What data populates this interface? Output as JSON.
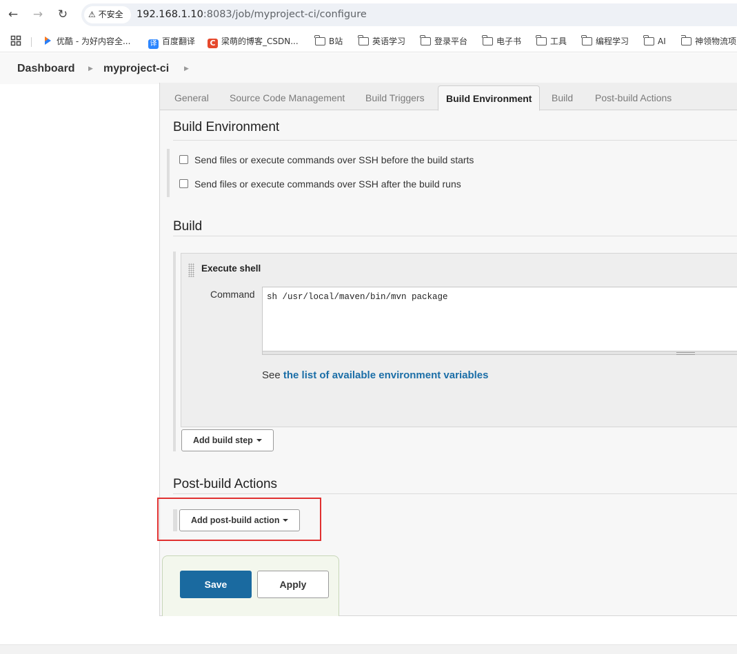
{
  "browser": {
    "security_label": "不安全",
    "url_host": "192.168.1.10",
    "url_rest": ":8083/job/myproject-ci/configure"
  },
  "bookmarks": [
    {
      "label": "优酷 - 为好内容全...",
      "icon": "youku-icon",
      "color": "#2b7ff6"
    },
    {
      "label": "百度翻译",
      "icon": "translate-icon",
      "color": "#2c86ff"
    },
    {
      "label": "梁萌的博客_CSDN...",
      "icon": "csdn-icon",
      "color": "#e6492d"
    },
    {
      "label": "B站",
      "icon": "folder-icon"
    },
    {
      "label": "英语学习",
      "icon": "folder-icon"
    },
    {
      "label": "登录平台",
      "icon": "folder-icon"
    },
    {
      "label": "电子书",
      "icon": "folder-icon"
    },
    {
      "label": "工具",
      "icon": "folder-icon"
    },
    {
      "label": "编程学习",
      "icon": "folder-icon"
    },
    {
      "label": "AI",
      "icon": "folder-icon"
    },
    {
      "label": "神领物流项",
      "icon": "folder-icon"
    }
  ],
  "breadcrumb": {
    "dashboard": "Dashboard",
    "project": "myproject-ci"
  },
  "tabs": [
    {
      "label": "General"
    },
    {
      "label": "Source Code Management"
    },
    {
      "label": "Build Triggers"
    },
    {
      "label": "Build Environment",
      "active": true
    },
    {
      "label": "Build"
    },
    {
      "label": "Post-build Actions"
    }
  ],
  "build_env": {
    "title": "Build Environment",
    "options": [
      {
        "label": "Send files or execute commands over SSH before the build starts",
        "checked": false
      },
      {
        "label": "Send files or execute commands over SSH after the build runs",
        "checked": false
      }
    ]
  },
  "build": {
    "title": "Build",
    "step_title": "Execute shell",
    "command_label": "Command",
    "command_value": "sh /usr/local/maven/bin/mvn package",
    "see_prefix": "See ",
    "see_link": "the list of available environment variables",
    "add_step": "Add build step"
  },
  "post_build": {
    "title": "Post-build Actions",
    "add_action": "Add post-build action"
  },
  "actions": {
    "save": "Save",
    "apply": "Apply"
  },
  "colors": {
    "primary": "#1a6aa0",
    "link": "#1b6ea7",
    "highlight": "#e03030"
  }
}
